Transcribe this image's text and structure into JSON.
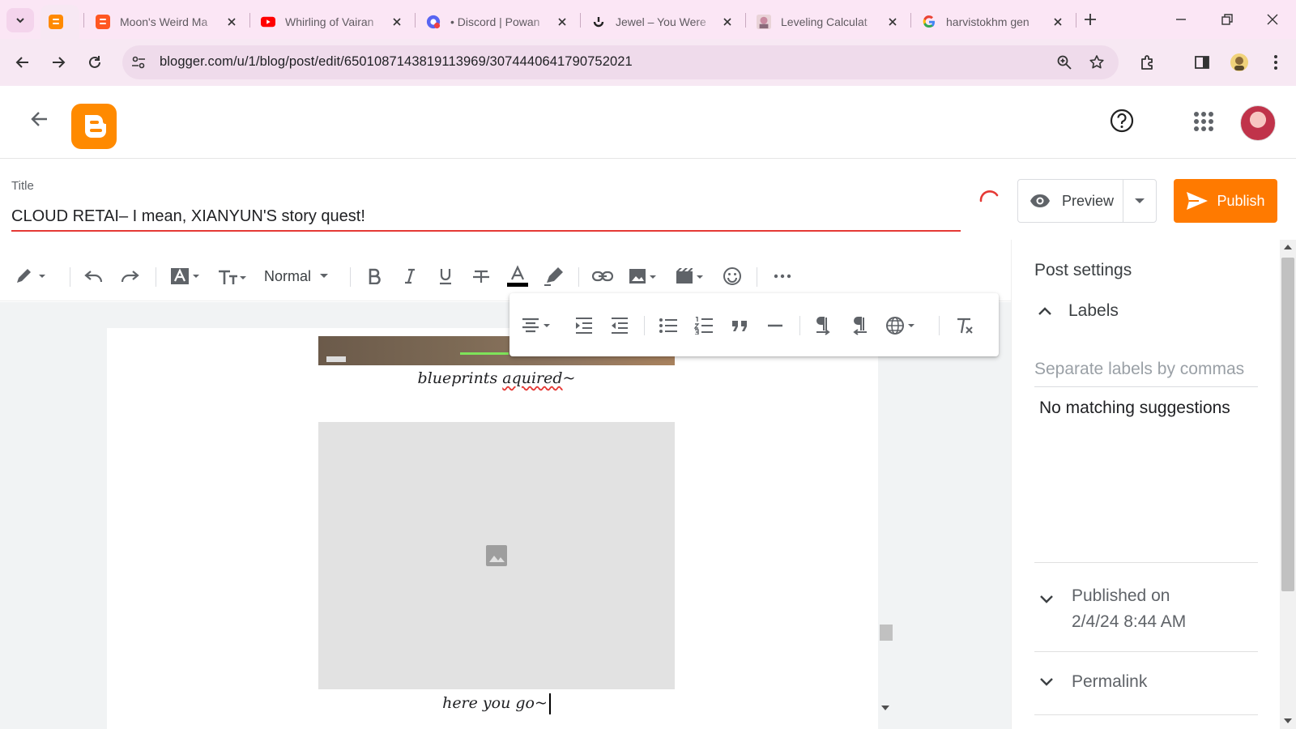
{
  "browser": {
    "tabs": [
      {
        "title": "",
        "favicon": "blogger-icon",
        "active": true
      },
      {
        "title": "Moon's Weird Ma",
        "favicon": "blogger-icon"
      },
      {
        "title": "Whirling of Vairan",
        "favicon": "youtube-icon"
      },
      {
        "title": "• Discord | Powan",
        "favicon": "discord-icon"
      },
      {
        "title": "Jewel – You Were",
        "favicon": "jewel-icon"
      },
      {
        "title": "Leveling Calculat",
        "favicon": "character-icon"
      },
      {
        "title": "harvistokhm gen",
        "favicon": "google-icon"
      }
    ],
    "url": "blogger.com/u/1/blog/post/edit/6501087143819113969/3074440641790752021",
    "colors": {
      "tab_strip": "#fbe6f5",
      "toolbar": "#f7e8f3",
      "accent": "#ff7a00"
    }
  },
  "editor": {
    "title_label": "Title",
    "title_value": "CLOUD RETAI– I mean, XIANYUN'S story quest!",
    "preview_label": "Preview",
    "publish_label": "Publish",
    "format_dropdown": "Normal",
    "caption1_pre": "blueprints ",
    "caption1_misspelled": "aquired",
    "caption1_post": "~",
    "caption2": "here you go~"
  },
  "sidebar": {
    "heading": "Post settings",
    "labels_title": "Labels",
    "labels_placeholder": "Separate labels by commas",
    "no_suggestions": "No matching suggestions",
    "published_label": "Published on",
    "published_date": "2/4/24 8:44 AM",
    "permalink_label": "Permalink"
  }
}
